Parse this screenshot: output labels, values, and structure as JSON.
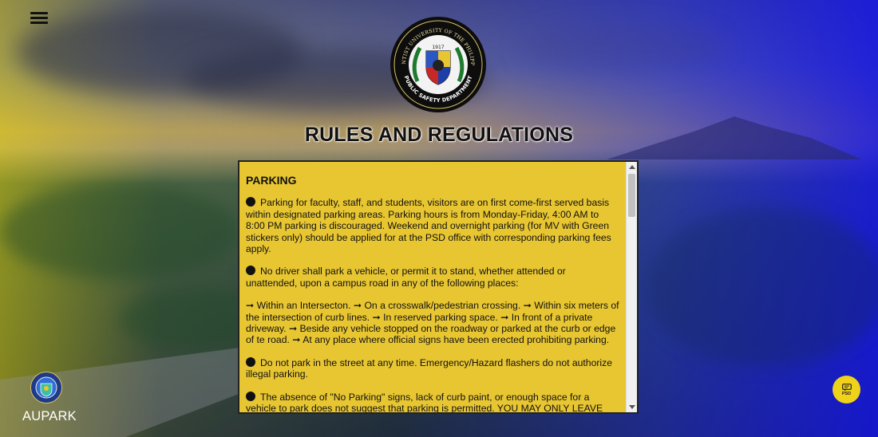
{
  "header": {
    "menu_icon": "hamburger-menu-icon",
    "seal": {
      "arc_text_top": "ADVENTIST UNIVERSITY OF THE PHILIPPINES",
      "year": "1917",
      "arc_text_bottom": "PUBLIC SAFETY DEPARTMENT"
    },
    "page_title": "RULES AND REGULATIONS"
  },
  "rules": {
    "heading": "PARKING",
    "paragraphs": [
      "Parking for faculty, staff, and students, visitors are on first come-first served basis within designated parking areas. Parking hours is from Monday-Friday, 4:00 AM to 8:00 PM parking is discouraged. Weekend and overnight parking (for MV with Green stickers only) should be applied for at the PSD office with corresponding parking fees apply.",
      "No driver shall park a vehicle, or permit it to stand, whether attended or unattended, upon a campus road in any of the following places:",
      "➞ Within an Intersecton. ➞ On a crosswalk/pedestrian crossing. ➞ Within six meters of the intersection of curb lines. ➞ In reserved parking space. ➞ In front of a private driveway. ➞ Beside any vehicle stopped on the roadway or parked at the curb or edge of te road. ➞ At any place where official signs have been erected prohibiting parking.",
      "Do not park in the street at any time. Emergency/Hazard flashers do not authorize illegal parking.",
      "The absence of \"No Parking\" signs, lack of curb paint, or enough space for a vehicle to park does not suggest that parking is permitted. YOU MAY ONLY LEAVE YOUR"
    ],
    "bulleted": [
      true,
      true,
      false,
      true,
      true
    ]
  },
  "brand": {
    "name": "AUPARK",
    "logo_icon": "aupark-logo-icon"
  },
  "chat": {
    "icon": "chat-bubble-icon",
    "label": "PSD"
  },
  "colors": {
    "rules_background": "#e8c632",
    "chat_button": "#f0d21a",
    "seal_ring": "#111111",
    "seal_green": "#1f7a2e"
  }
}
